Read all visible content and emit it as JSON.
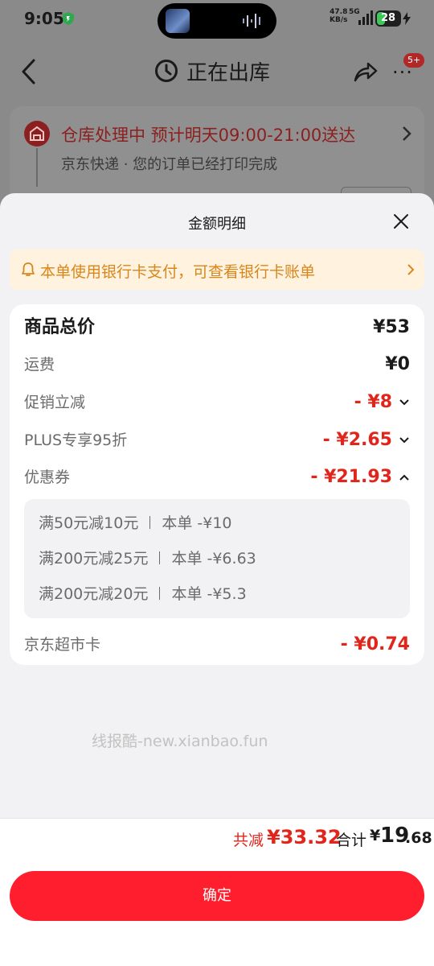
{
  "status_bar": {
    "time": "9:05",
    "net_speed_value": "47.8",
    "net_speed_unit": "KB/s",
    "network": "5G",
    "battery": "28"
  },
  "nav": {
    "title": "正在出库",
    "badge": "5+"
  },
  "order": {
    "status": "仓库处理中 预计明天09:00-21:00送达",
    "sub": "京东快递 · 您的订单已经打印完成"
  },
  "sheet": {
    "title": "金额明细",
    "notice": "本单使用银行卡支付，可查看银行卡账单",
    "rows": [
      {
        "label": "商品总价",
        "value": "¥53"
      },
      {
        "label": "运费",
        "value": "¥0"
      },
      {
        "label": "促销立减",
        "value": "- ¥8"
      },
      {
        "label": "PLUS专享95折",
        "value": "- ¥2.65"
      },
      {
        "label": "优惠券",
        "value": "- ¥21.93"
      },
      {
        "label": "京东超市卡",
        "value": "- ¥0.74"
      }
    ],
    "coupons": [
      {
        "rule": "满50元减10元",
        "applied": "本单 -¥10"
      },
      {
        "rule": "满200元减25元",
        "applied": "本单 -¥6.63"
      },
      {
        "rule": "满200元减20元",
        "applied": "本单 -¥5.3"
      }
    ],
    "watermark": "线报酷-new.xianbao.fun",
    "totals": {
      "discount_label": "共减",
      "discount": "¥33.32",
      "total_label": "合计",
      "currency": "¥",
      "total_int": "19",
      "total_dec": ".68"
    },
    "confirm_label": "确定"
  },
  "colors": {
    "accent_red": "#e1251b",
    "confirm_red": "#ff1e2d",
    "notice_bg": "#fff2df",
    "notice_text": "#d9861a"
  }
}
